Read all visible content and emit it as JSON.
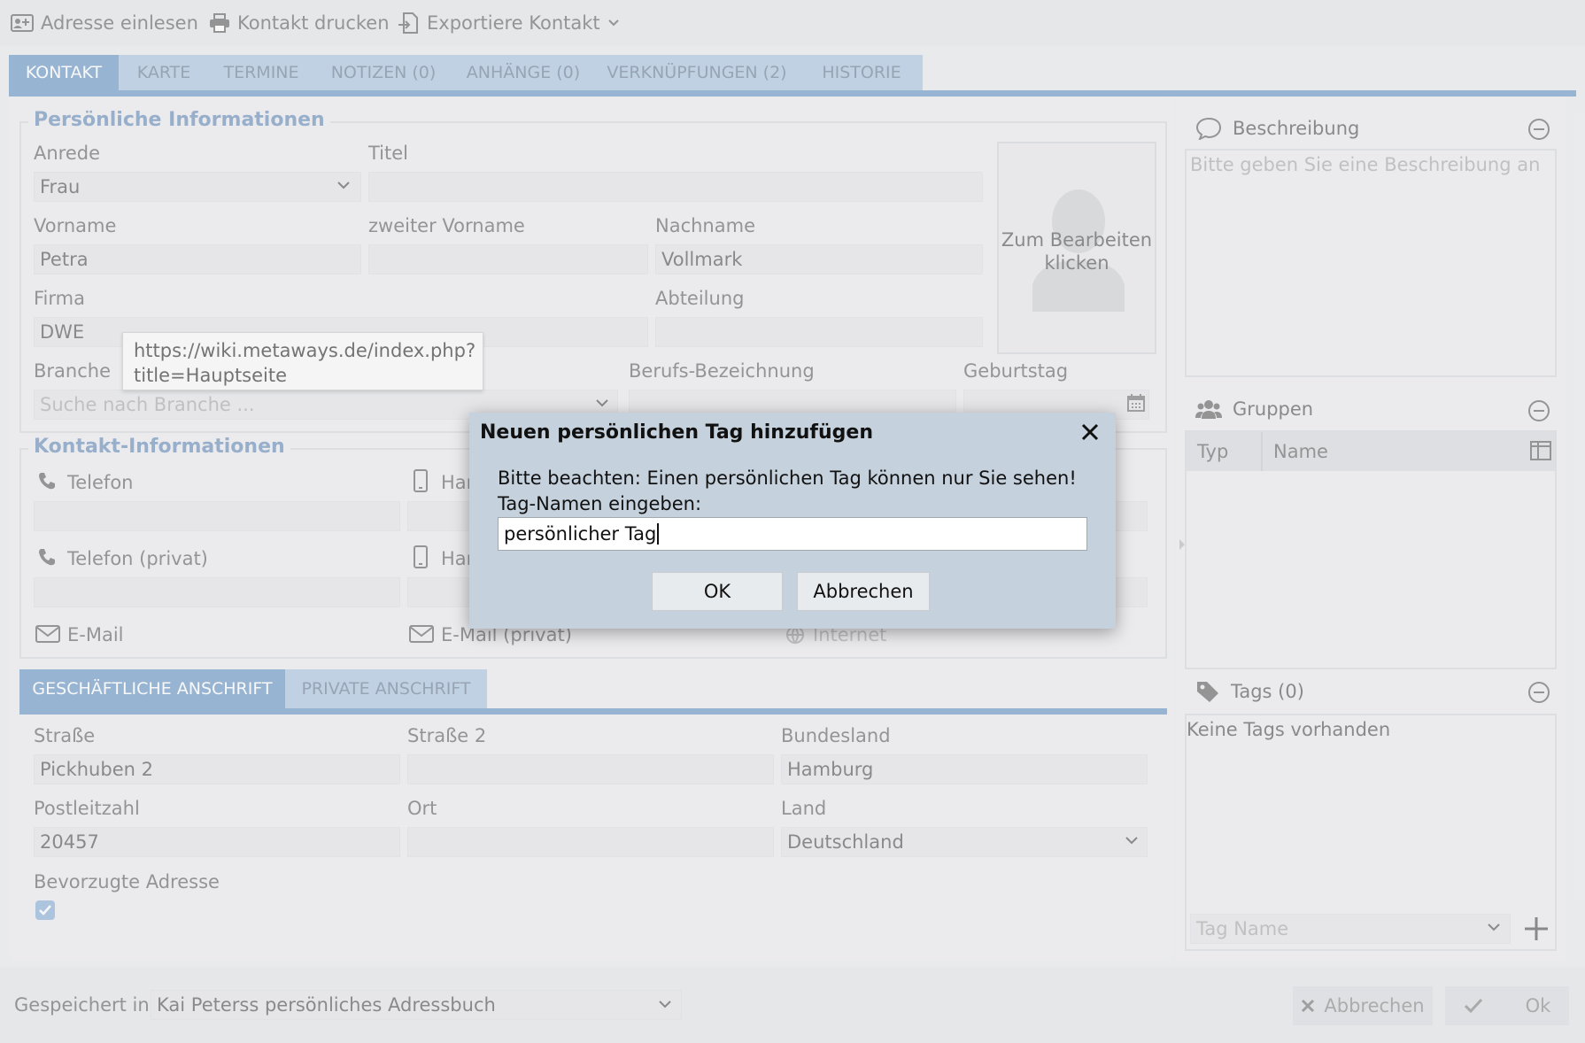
{
  "toolbar": {
    "import_address": "Adresse einlesen",
    "print_contact": "Kontakt drucken",
    "export_contact": "Exportiere Kontakt"
  },
  "tabs": [
    {
      "label": "KONTAKT"
    },
    {
      "label": "KARTE"
    },
    {
      "label": "TERMINE"
    },
    {
      "label": "NOTIZEN (0)"
    },
    {
      "label": "ANHÄNGE (0)"
    },
    {
      "label": "VERKNÜPFUNGEN (2)"
    },
    {
      "label": "HISTORIE"
    }
  ],
  "personal": {
    "legend": "Persönliche Informationen",
    "salutation_label": "Anrede",
    "salutation_value": "Frau",
    "title_label": "Titel",
    "title_value": "",
    "firstname_label": "Vorname",
    "firstname_value": "Petra",
    "middlename_label": "zweiter Vorname",
    "middlename_value": "",
    "lastname_label": "Nachname",
    "lastname_value": "Vollmark",
    "company_label": "Firma",
    "company_value": "DWE",
    "department_label": "Abteilung",
    "department_value": "",
    "industry_label": "Branche",
    "industry_placeholder": "Suche nach Branche ...",
    "job_label": "Berufs-Bezeichnung",
    "job_value": "",
    "birthday_label": "Geburtstag",
    "birthday_value": "",
    "photo_text_1": "Zum Bearbeiten",
    "photo_text_2": "klicken"
  },
  "tooltip": {
    "line1": "https://wiki.metaways.de/index.php?",
    "line2": "title=Hauptseite"
  },
  "contact": {
    "legend": "Kontakt-Informationen",
    "phone_label": "Telefon",
    "mobile_label": "Har",
    "phone_private_label": "Telefon (privat)",
    "mobile_private_label": "Har",
    "email_label": "E-Mail",
    "email_private_label": "E-Mail (privat)",
    "internet_label": "Internet"
  },
  "address_tabs": [
    {
      "label": "GESCHÄFTLICHE ANSCHRIFT"
    },
    {
      "label": "PRIVATE ANSCHRIFT"
    }
  ],
  "address": {
    "street_label": "Straße",
    "street_value": "Pickhuben 2",
    "street2_label": "Straße 2",
    "street2_value": "",
    "state_label": "Bundesland",
    "state_value": "Hamburg",
    "zip_label": "Postleitzahl",
    "zip_value": "20457",
    "city_label": "Ort",
    "city_value": "",
    "country_label": "Land",
    "country_value": "Deutschland",
    "preferred_label": "Bevorzugte Adresse",
    "preferred_checked": true
  },
  "side": {
    "description_title": "Beschreibung",
    "description_placeholder": "Bitte geben Sie eine Beschreibung an",
    "groups_title": "Gruppen",
    "groups_col_type": "Typ",
    "groups_col_name": "Name",
    "tags_title": "Tags (0)",
    "tags_empty": "Keine Tags vorhanden",
    "tag_name_placeholder": "Tag Name"
  },
  "bottom": {
    "saved_in_label": "Gespeichert in",
    "saved_in_value": "Kai Peterss persönliches Adressbuch",
    "cancel": "Abbrechen",
    "ok": "Ok"
  },
  "dialog": {
    "title": "Neuen persönlichen Tag hinzufügen",
    "message_1": "Bitte beachten: Einen persönlichen Tag können nur Sie sehen!",
    "message_2": "Tag-Namen eingeben:",
    "input_value": "persönlicher Tag",
    "ok": "OK",
    "cancel": "Abbrechen"
  },
  "colors": {
    "accent": "#6b98c4",
    "tab_inactive": "#a9c3de",
    "dialog_bg": "#c5d1dc",
    "legend_text": "#6a8fb8"
  }
}
